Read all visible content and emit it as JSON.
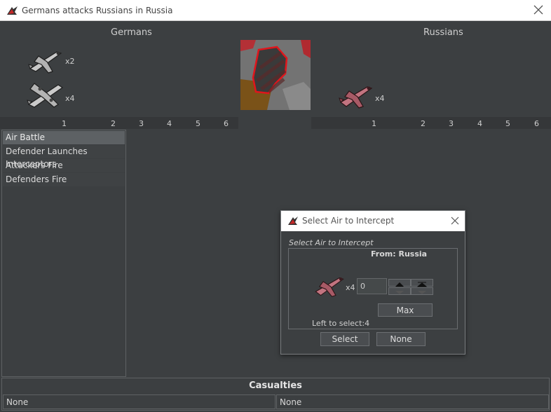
{
  "window": {
    "title": "Germans attacks Russians in Russia",
    "close_icon": "close-icon",
    "app_icon": "game-icon"
  },
  "attacker": {
    "name": "Germans",
    "units": [
      {
        "icon": "fighter-plane-icon",
        "count": "x2"
      },
      {
        "icon": "bomber-plane-icon",
        "count": "x4"
      }
    ],
    "dice": [
      "1",
      "2",
      "3",
      "4",
      "5",
      "6"
    ]
  },
  "defender": {
    "name": "Russians",
    "units": [
      {
        "icon": "fighter-plane-icon",
        "count": "x4"
      }
    ],
    "dice": [
      "1",
      "2",
      "3",
      "4",
      "5",
      "6"
    ]
  },
  "territory": {
    "icon": "territory-map-icon"
  },
  "steps": [
    "Air Battle",
    "Defender Launches Interceptors",
    "Attackers Fire",
    "Defenders Fire"
  ],
  "casualties": {
    "title": "Casualties",
    "left": "None",
    "right": "None"
  },
  "dialog": {
    "title": "Select Air to Intercept",
    "subtitle": "Select Air to Intercept",
    "from": "From: Russia",
    "unit_count": "x4",
    "quantity": "0",
    "max_label": "Max",
    "left_to_select": "Left to select:4",
    "select_label": "Select",
    "none_label": "None"
  },
  "colors": {
    "background": "#3c3f41",
    "german_plane": "#b9b9b9",
    "russian_plane": "#b05a66",
    "territory_border": "#e0151c"
  }
}
